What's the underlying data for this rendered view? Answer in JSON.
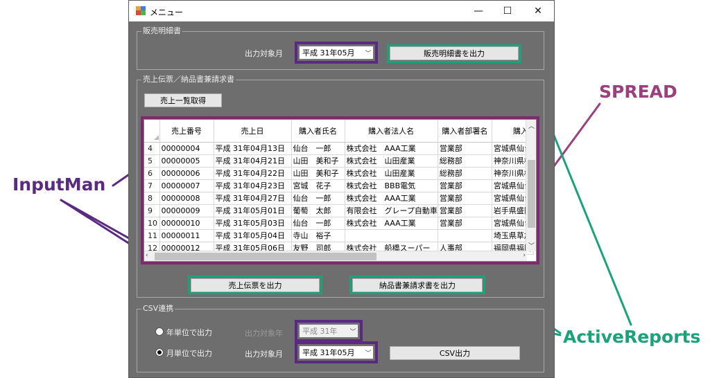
{
  "window": {
    "title": "メニュー",
    "minimize": "—",
    "maximize": "☐",
    "close": "✕"
  },
  "sales_detail": {
    "group_title": "販売明細書",
    "month_label": "出力対象月",
    "month_value": "平成 31年05月",
    "output_button": "販売明細書を出力"
  },
  "invoice": {
    "group_title": "売上伝票／納品書兼請求書",
    "fetch_button": "売上一覧取得",
    "slip_button": "売上伝票を出力",
    "invoice_button": "納品書兼請求書を出力",
    "grid": {
      "columns": [
        "売上番号",
        "売上日",
        "購入者氏名",
        "購入者法人名",
        "購入者部署名",
        "購入"
      ],
      "rows": [
        {
          "n": "4",
          "cells": [
            "00000004",
            "平成 31年04月13日",
            "仙台　一郎",
            "株式会社　AAA工業",
            "営業部",
            "宮城県仙台"
          ]
        },
        {
          "n": "5",
          "cells": [
            "00000005",
            "平成 31年04月21日",
            "山田　美和子",
            "株式会社　山田産業",
            "総務部",
            "神奈川県横"
          ]
        },
        {
          "n": "6",
          "cells": [
            "00000006",
            "平成 31年04月22日",
            "山田　美和子",
            "株式会社　山田産業",
            "総務部",
            "神奈川県横"
          ]
        },
        {
          "n": "7",
          "cells": [
            "00000007",
            "平成 31年04月23日",
            "宮城　花子",
            "株式会社　BBB電気",
            "営業部",
            "宮城県仙台"
          ]
        },
        {
          "n": "8",
          "cells": [
            "00000008",
            "平成 31年04月27日",
            "仙台　一郎",
            "株式会社　AAA工業",
            "営業部",
            "宮城県仙台"
          ]
        },
        {
          "n": "9",
          "cells": [
            "00000009",
            "平成 31年05月01日",
            "葡萄　太郎",
            "有限会社　グレープ自動車",
            "営業部",
            "岩手県盛岡"
          ]
        },
        {
          "n": "10",
          "cells": [
            "00000010",
            "平成 31年05月03日",
            "仙台　一郎",
            "株式会社　AAA工業",
            "営業部",
            "宮城県仙台"
          ]
        },
        {
          "n": "11",
          "cells": [
            "00000011",
            "平成 31年05月04日",
            "寺山　裕子",
            "",
            "",
            "埼玉県草加"
          ]
        },
        {
          "n": "12",
          "cells": [
            "00000012",
            "平成 31年05月06日",
            "友野　司郎",
            "株式会社　船橋スーパー",
            "人事部",
            "福岡県福岡"
          ]
        }
      ]
    }
  },
  "csv": {
    "group_title": "CSV連携",
    "year_option": "年単位で出力",
    "month_option": "月単位で出力",
    "year_label": "出力対象年",
    "year_value": "平成 31年",
    "month_label": "出力対象月",
    "month_value": "平成 31年05月",
    "csv_button": "CSV出力"
  },
  "annotations": {
    "inputman": "InputMan",
    "spread": "SPREAD",
    "activereports": "ActiveReports",
    "colors": {
      "purple": "#5a2a82",
      "green": "#1aa37a",
      "magenta": "#9b3f7e"
    }
  }
}
